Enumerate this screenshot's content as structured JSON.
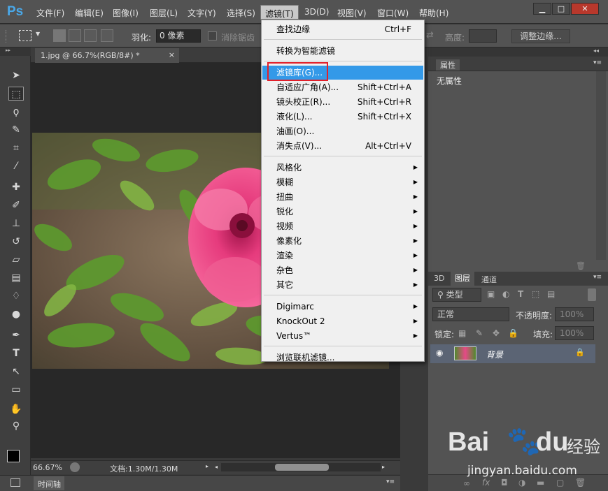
{
  "app": {
    "logo": "Ps"
  },
  "menubar": {
    "items": [
      "文件(F)",
      "编辑(E)",
      "图像(I)",
      "图层(L)",
      "文字(Y)",
      "选择(S)",
      "滤镜(T)",
      "3D(D)",
      "视图(V)",
      "窗口(W)",
      "帮助(H)"
    ],
    "window_buttons": {
      "minimize": "▁",
      "maximize": "□",
      "close": "✕"
    }
  },
  "options": {
    "feather_label": "羽化:",
    "feather_value": "0 像素",
    "antialias_label": "消除锯齿",
    "height_label": "高度:",
    "refine_edge": "调整边缘..."
  },
  "document": {
    "tab_title": "1.jpg @ 66.7%(RGB/8#) *",
    "tab_close": "×",
    "zoom": "66.67%",
    "doc_info": "文档:1.30M/1.30M"
  },
  "timeline": {
    "label": "时间轴"
  },
  "filter_menu": {
    "sections": [
      [
        {
          "label": "查找边缘",
          "shortcut": "Ctrl+F"
        }
      ],
      [
        {
          "label": "转换为智能滤镜"
        }
      ],
      [
        {
          "label": "滤镜库(G)...",
          "highlighted": true
        },
        {
          "label": "自适应广角(A)...",
          "shortcut": "Shift+Ctrl+A"
        },
        {
          "label": "镜头校正(R)...",
          "shortcut": "Shift+Ctrl+R"
        },
        {
          "label": "液化(L)...",
          "shortcut": "Shift+Ctrl+X"
        },
        {
          "label": "油画(O)..."
        },
        {
          "label": "消失点(V)...",
          "shortcut": "Alt+Ctrl+V"
        }
      ],
      [
        {
          "label": "风格化",
          "submenu": true
        },
        {
          "label": "模糊",
          "submenu": true
        },
        {
          "label": "扭曲",
          "submenu": true
        },
        {
          "label": "锐化",
          "submenu": true
        },
        {
          "label": "视频",
          "submenu": true
        },
        {
          "label": "像素化",
          "submenu": true
        },
        {
          "label": "渲染",
          "submenu": true
        },
        {
          "label": "杂色",
          "submenu": true
        },
        {
          "label": "其它",
          "submenu": true
        }
      ],
      [
        {
          "label": "Digimarc",
          "submenu": true
        },
        {
          "label": "KnockOut 2",
          "submenu": true
        },
        {
          "label": "Vertus™",
          "submenu": true
        }
      ],
      [
        {
          "label": "浏览联机滤镜..."
        }
      ]
    ]
  },
  "properties_panel": {
    "title": "属性",
    "content": "无属性"
  },
  "layers_panel": {
    "tabs": [
      "3D",
      "图层",
      "通道"
    ],
    "kind_filter": "类型",
    "blend_mode": "正常",
    "opacity_label": "不透明度:",
    "opacity_value": "100%",
    "lock_label": "锁定:",
    "fill_label": "填充:",
    "fill_value": "100%",
    "layer_name": "背景"
  },
  "watermark": {
    "brand_a": "Bai",
    "brand_b": "du",
    "brand_cn": "经验",
    "url": "jingyan.baidu.com"
  },
  "colors": {
    "accent": "#3399e8",
    "highlight_box": "#e2202a",
    "ui_bg": "#535353"
  }
}
